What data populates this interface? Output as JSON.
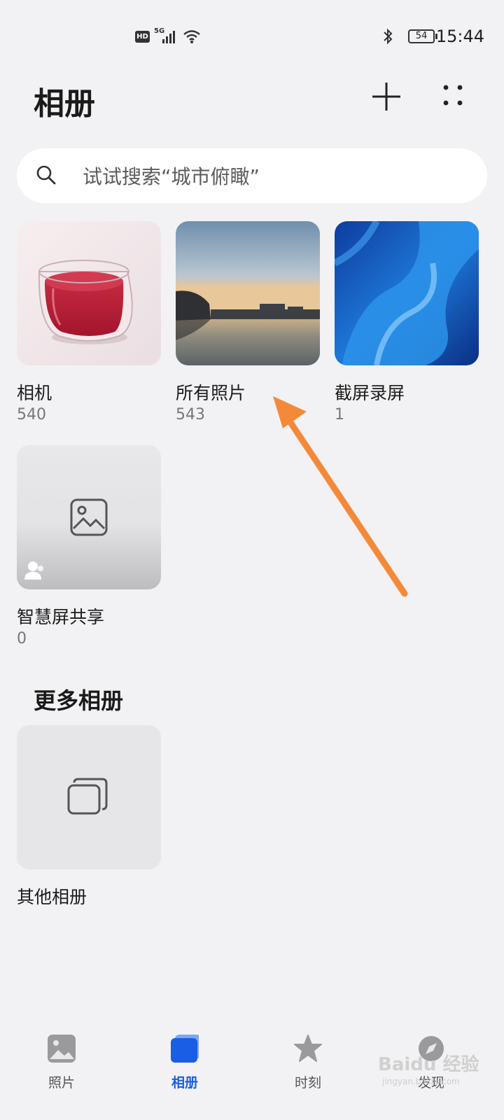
{
  "status_bar": {
    "time": "15:44",
    "battery": "54",
    "network_badge": "HD",
    "network_type": "5G",
    "icons": [
      "hd-icon",
      "signal-icon",
      "wifi-icon",
      "bluetooth-icon",
      "battery-icon"
    ]
  },
  "header": {
    "title": "相册",
    "add_icon": "plus-icon",
    "more_icon": "dots-grid-icon"
  },
  "search": {
    "placeholder": "试试搜索“城市俯瞰”",
    "icon": "search-icon"
  },
  "albums": [
    {
      "name": "相机",
      "count": "540",
      "thumb": "red-drink-glass-photo"
    },
    {
      "name": "所有照片",
      "count": "543",
      "thumb": "sunset-lake-photo"
    },
    {
      "name": "截屏录屏",
      "count": "1",
      "thumb": "blue-abstract-wallpaper"
    },
    {
      "name": "智慧屏共享",
      "count": "0",
      "thumb": "image-placeholder-icon"
    }
  ],
  "more_albums": {
    "title": "更多相册",
    "items": [
      {
        "name": "其他相册",
        "thumb": "stacked-albums-icon"
      }
    ]
  },
  "bottom_nav": {
    "items": [
      {
        "label": "照片",
        "icon": "photo-icon",
        "active": false
      },
      {
        "label": "相册",
        "icon": "album-icon",
        "active": true
      },
      {
        "label": "时刻",
        "icon": "star-icon",
        "active": false
      },
      {
        "label": "发现",
        "icon": "discover-icon",
        "active": false
      }
    ]
  },
  "watermark": {
    "text": "Baidu 经验",
    "sub": "jingyan.baidu.com"
  },
  "colors": {
    "background": "#f2f2f4",
    "accent": "#1a5ee6",
    "annotation_arrow": "#f5893a"
  }
}
